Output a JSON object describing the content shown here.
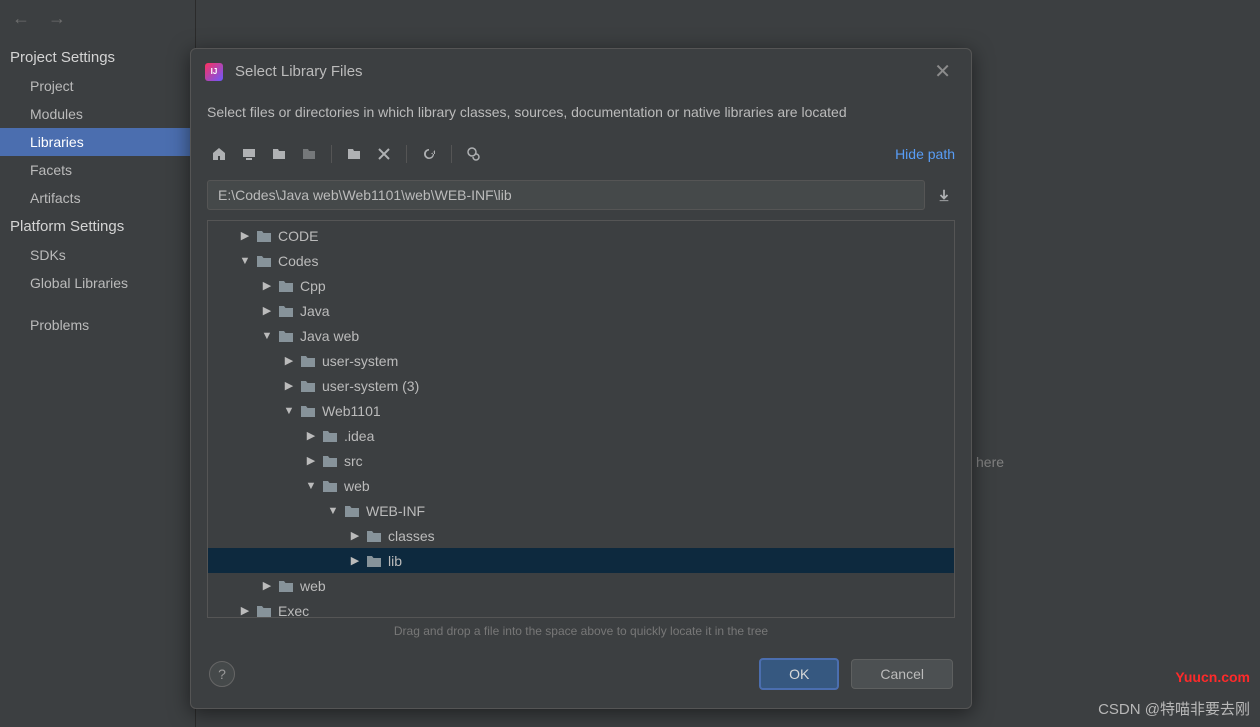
{
  "sidebar": {
    "section1": "Project Settings",
    "items1": [
      "Project",
      "Modules",
      "Libraries",
      "Facets",
      "Artifacts"
    ],
    "active_index": 2,
    "section2": "Platform Settings",
    "items2": [
      "SDKs",
      "Global Libraries"
    ],
    "problems": "Problems"
  },
  "dialog": {
    "title": "Select Library Files",
    "subtitle": "Select files or directories in which library classes, sources, documentation or native libraries are located",
    "hide_path": "Hide path",
    "path": "E:\\Codes\\Java web\\Web1101\\web\\WEB-INF\\lib",
    "drag_hint": "Drag and drop a file into the space above to quickly locate it in the tree",
    "ok": "OK",
    "cancel": "Cancel"
  },
  "tree": [
    {
      "label": "CODE",
      "depth": 1,
      "expanded": false
    },
    {
      "label": "Codes",
      "depth": 1,
      "expanded": true
    },
    {
      "label": "Cpp",
      "depth": 2,
      "expanded": false
    },
    {
      "label": "Java",
      "depth": 2,
      "expanded": false
    },
    {
      "label": "Java web",
      "depth": 2,
      "expanded": true
    },
    {
      "label": "user-system",
      "depth": 3,
      "expanded": false
    },
    {
      "label": "user-system (3)",
      "depth": 3,
      "expanded": false
    },
    {
      "label": "Web1101",
      "depth": 3,
      "expanded": true
    },
    {
      "label": ".idea",
      "depth": 4,
      "expanded": false
    },
    {
      "label": "src",
      "depth": 4,
      "expanded": false
    },
    {
      "label": "web",
      "depth": 4,
      "expanded": true
    },
    {
      "label": "WEB-INF",
      "depth": 5,
      "expanded": true
    },
    {
      "label": "classes",
      "depth": 6,
      "expanded": false
    },
    {
      "label": "lib",
      "depth": 6,
      "expanded": false,
      "selected": true
    },
    {
      "label": "web",
      "depth": 2,
      "expanded": false
    },
    {
      "label": "Exec",
      "depth": 1,
      "expanded": false
    }
  ],
  "hint_text": "here",
  "watermark1": "Yuucn.com",
  "watermark2": "CSDN @特喵非要去刚"
}
